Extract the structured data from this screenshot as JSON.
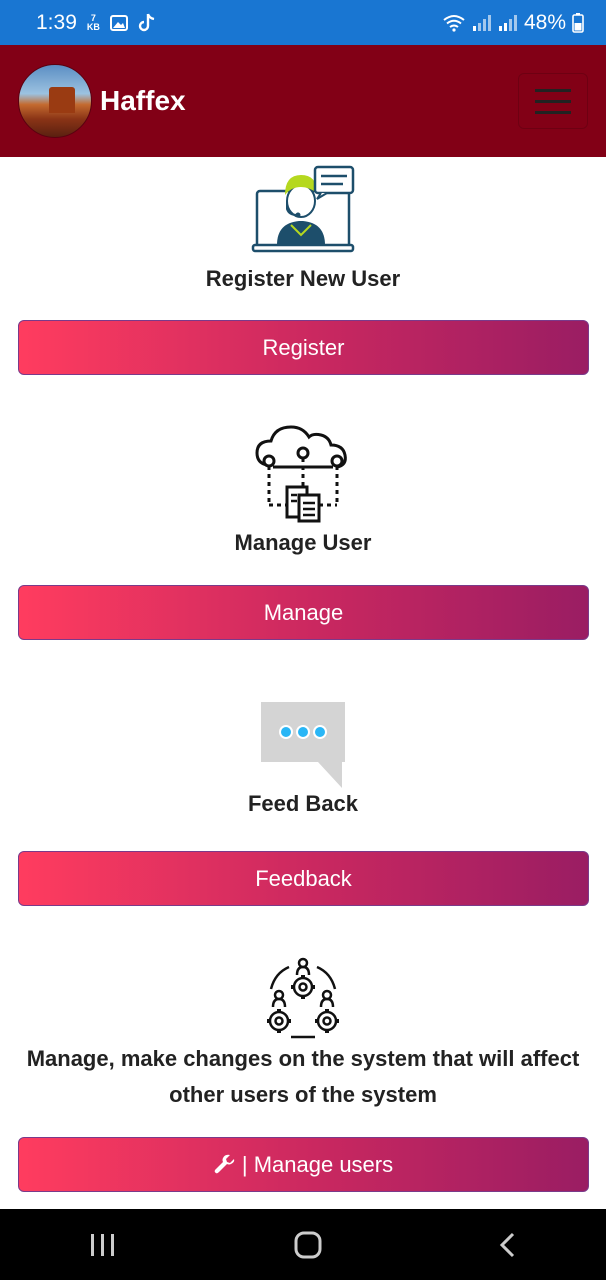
{
  "status_bar": {
    "time": "1:39",
    "kb_top": "7",
    "kb_bottom": "KB",
    "battery": "48%"
  },
  "header": {
    "brand": "Haffex"
  },
  "sections": [
    {
      "title": "Register New User",
      "button": "Register"
    },
    {
      "title": "Manage User",
      "button": "Manage"
    },
    {
      "title": "Feed Back",
      "button": "Feedback"
    },
    {
      "title": "Manage, make changes on the system that will affect other users of the system",
      "button": "| Manage users"
    }
  ],
  "colors": {
    "status_bar": "#1976d2",
    "header": "#820016",
    "button_start": "#ff3c5f",
    "button_end": "#9a1d63"
  },
  "icons": [
    "wifi-icon",
    "signal-icon",
    "battery-icon",
    "gallery-icon",
    "tiktok-icon",
    "menu-icon",
    "support-agent-icon",
    "cloud-network-icon",
    "chat-bubble-icon",
    "team-gears-icon",
    "wrench-icon",
    "recent-apps-icon",
    "home-icon",
    "back-icon"
  ]
}
